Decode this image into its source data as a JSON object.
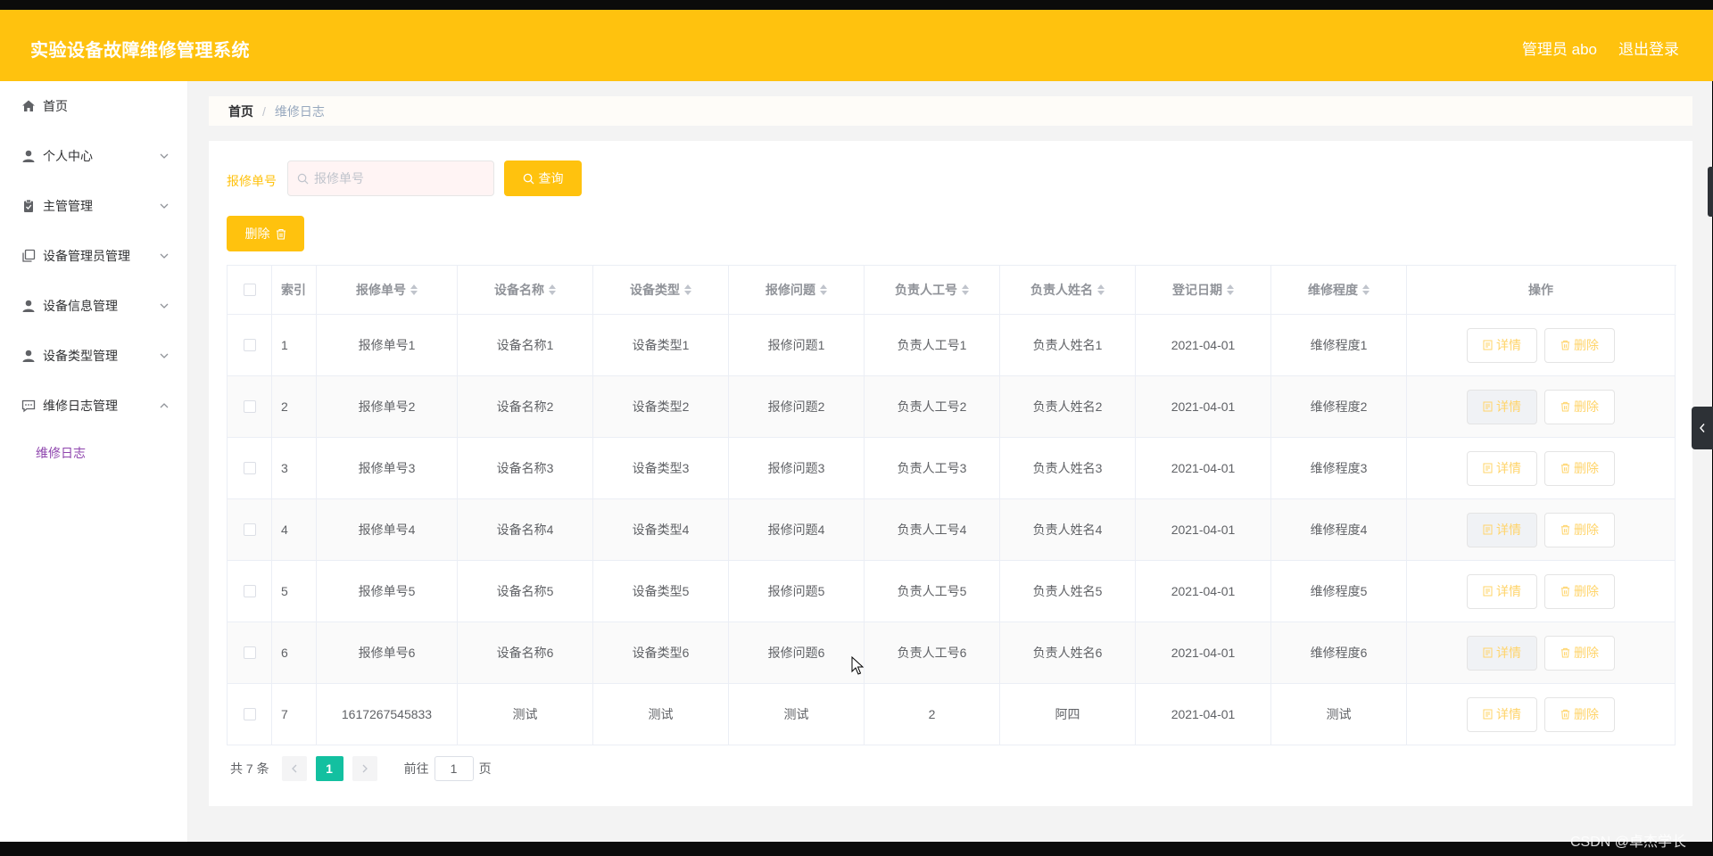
{
  "header": {
    "title": "实验设备故障维修管理系统",
    "user_label": "管理员 abo",
    "logout_label": "退出登录"
  },
  "sidebar": {
    "items": [
      {
        "label": "首页",
        "icon": "home-icon",
        "has_children": false
      },
      {
        "label": "个人中心",
        "icon": "user-icon",
        "has_children": true
      },
      {
        "label": "主管管理",
        "icon": "clipboard-icon",
        "has_children": true
      },
      {
        "label": "设备管理员管理",
        "icon": "copy-icon",
        "has_children": true
      },
      {
        "label": "设备信息管理",
        "icon": "user-icon",
        "has_children": true
      },
      {
        "label": "设备类型管理",
        "icon": "user-icon",
        "has_children": true
      },
      {
        "label": "维修日志管理",
        "icon": "chat-icon",
        "has_children": true,
        "expanded": true
      }
    ],
    "submenu": [
      {
        "label": "维修日志",
        "active": true
      }
    ]
  },
  "breadcrumb": {
    "home": "首页",
    "separator": "/",
    "current": "维修日志"
  },
  "search": {
    "label": "报修单号",
    "placeholder": "报修单号",
    "query_label": "查询"
  },
  "toolbar": {
    "delete_label": "删除"
  },
  "table": {
    "headers": {
      "index": "索引",
      "repair_no": "报修单号",
      "device_name": "设备名称",
      "device_type": "设备类型",
      "problem": "报修问题",
      "staff_no": "负责人工号",
      "staff_name": "负责人姓名",
      "date": "登记日期",
      "level": "维修程度",
      "ops": "操作"
    },
    "detail_label": "详情",
    "delete_label": "删除",
    "rows": [
      {
        "index": "1",
        "repair_no": "报修单号1",
        "device_name": "设备名称1",
        "device_type": "设备类型1",
        "problem": "报修问题1",
        "staff_no": "负责人工号1",
        "staff_name": "负责人姓名1",
        "date": "2021-04-01",
        "level": "维修程度1"
      },
      {
        "index": "2",
        "repair_no": "报修单号2",
        "device_name": "设备名称2",
        "device_type": "设备类型2",
        "problem": "报修问题2",
        "staff_no": "负责人工号2",
        "staff_name": "负责人姓名2",
        "date": "2021-04-01",
        "level": "维修程度2"
      },
      {
        "index": "3",
        "repair_no": "报修单号3",
        "device_name": "设备名称3",
        "device_type": "设备类型3",
        "problem": "报修问题3",
        "staff_no": "负责人工号3",
        "staff_name": "负责人姓名3",
        "date": "2021-04-01",
        "level": "维修程度3"
      },
      {
        "index": "4",
        "repair_no": "报修单号4",
        "device_name": "设备名称4",
        "device_type": "设备类型4",
        "problem": "报修问题4",
        "staff_no": "负责人工号4",
        "staff_name": "负责人姓名4",
        "date": "2021-04-01",
        "level": "维修程度4"
      },
      {
        "index": "5",
        "repair_no": "报修单号5",
        "device_name": "设备名称5",
        "device_type": "设备类型5",
        "problem": "报修问题5",
        "staff_no": "负责人工号5",
        "staff_name": "负责人姓名5",
        "date": "2021-04-01",
        "level": "维修程度5"
      },
      {
        "index": "6",
        "repair_no": "报修单号6",
        "device_name": "设备名称6",
        "device_type": "设备类型6",
        "problem": "报修问题6",
        "staff_no": "负责人工号6",
        "staff_name": "负责人姓名6",
        "date": "2021-04-01",
        "level": "维修程度6"
      },
      {
        "index": "7",
        "repair_no": "1617267545833",
        "device_name": "测试",
        "device_type": "测试",
        "problem": "测试",
        "staff_no": "2",
        "staff_name": "阿四",
        "date": "2021-04-01",
        "level": "测试"
      }
    ]
  },
  "pagination": {
    "total_label": "共 7 条",
    "current_page": "1",
    "goto_label": "前往",
    "goto_value": "1",
    "page_suffix": "页"
  },
  "watermark": "CSDN @卓杰学长",
  "colors": {
    "brand": "#ffc20e",
    "active_page": "#13c0a0",
    "active_submenu": "#8e44ad"
  }
}
